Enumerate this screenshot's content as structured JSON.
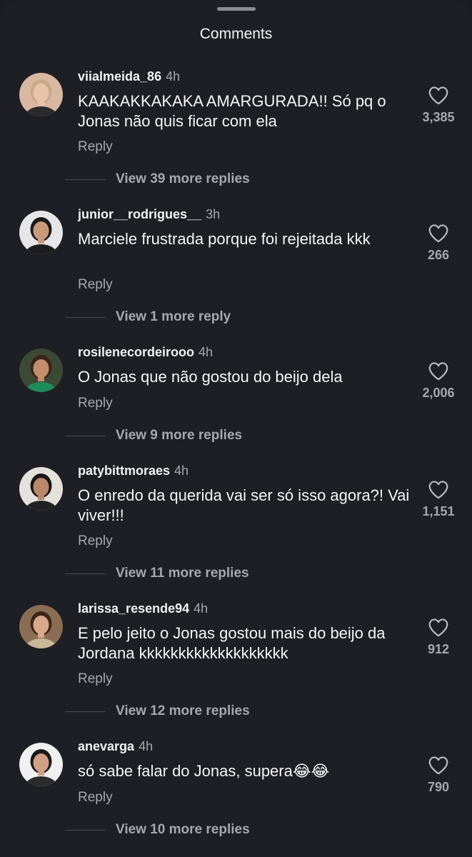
{
  "sheet": {
    "title": "Comments"
  },
  "comments": [
    {
      "username": "viialmeida_86",
      "time": "4h",
      "text": "KAAKAKKAKAKA AMARGURADA!! Só pq o Jonas não quis ficar com ela",
      "likes": "3,385",
      "reply_label": "Reply",
      "more_replies": "View 39 more replies",
      "avatar": {
        "bg": "#d9b8a2",
        "skin": "#e8c3aa",
        "hair": "#c9a98a",
        "top": "#2a2a2a"
      }
    },
    {
      "username": "junior__rodrigues__",
      "time": "3h",
      "text": "Marciele frustrada porque foi rejeitada kkk",
      "likes": "266",
      "reply_label": "Reply",
      "more_replies": "View 1 more reply",
      "avatar": {
        "bg": "#e6e6e6",
        "skin": "#c99a7a",
        "hair": "#1a1a1a",
        "top": "#1d1d1d"
      }
    },
    {
      "username": "rosilenecordeirooo",
      "time": "4h",
      "text": "O Jonas que não gostou do beijo dela",
      "likes": "2,006",
      "reply_label": "Reply",
      "more_replies": "View 9 more replies",
      "avatar": {
        "bg": "#3c4a35",
        "skin": "#c48d6b",
        "hair": "#3a2418",
        "top": "#1f8d5a"
      }
    },
    {
      "username": "patybittmoraes",
      "time": "4h",
      "text": "O enredo da querida vai ser só isso agora?! Vai viver!!!",
      "likes": "1,151",
      "reply_label": "Reply",
      "more_replies": "View 11 more replies",
      "avatar": {
        "bg": "#e4e0dc",
        "skin": "#b9876a",
        "hair": "#1b1412",
        "top": "#222222"
      }
    },
    {
      "username": "larissa_resende94",
      "time": "4h",
      "text": "E pelo jeito o Jonas gostou mais do beijo da Jordana kkkkkkkkkkkkkkkkkkk",
      "likes": "912",
      "reply_label": "Reply",
      "more_replies": "View 12 more replies",
      "avatar": {
        "bg": "#8a6d54",
        "skin": "#d7a98a",
        "hair": "#3d2617",
        "top": "#c9b79a"
      }
    },
    {
      "username": "anevarga",
      "time": "4h",
      "text": "só sabe falar do Jonas, supera😂😂",
      "likes": "790",
      "reply_label": "Reply",
      "more_replies": "View 10 more replies",
      "avatar": {
        "bg": "#f0f0f0",
        "skin": "#d1a084",
        "hair": "#1a1a1a",
        "top": "#2b2b2b"
      }
    }
  ]
}
